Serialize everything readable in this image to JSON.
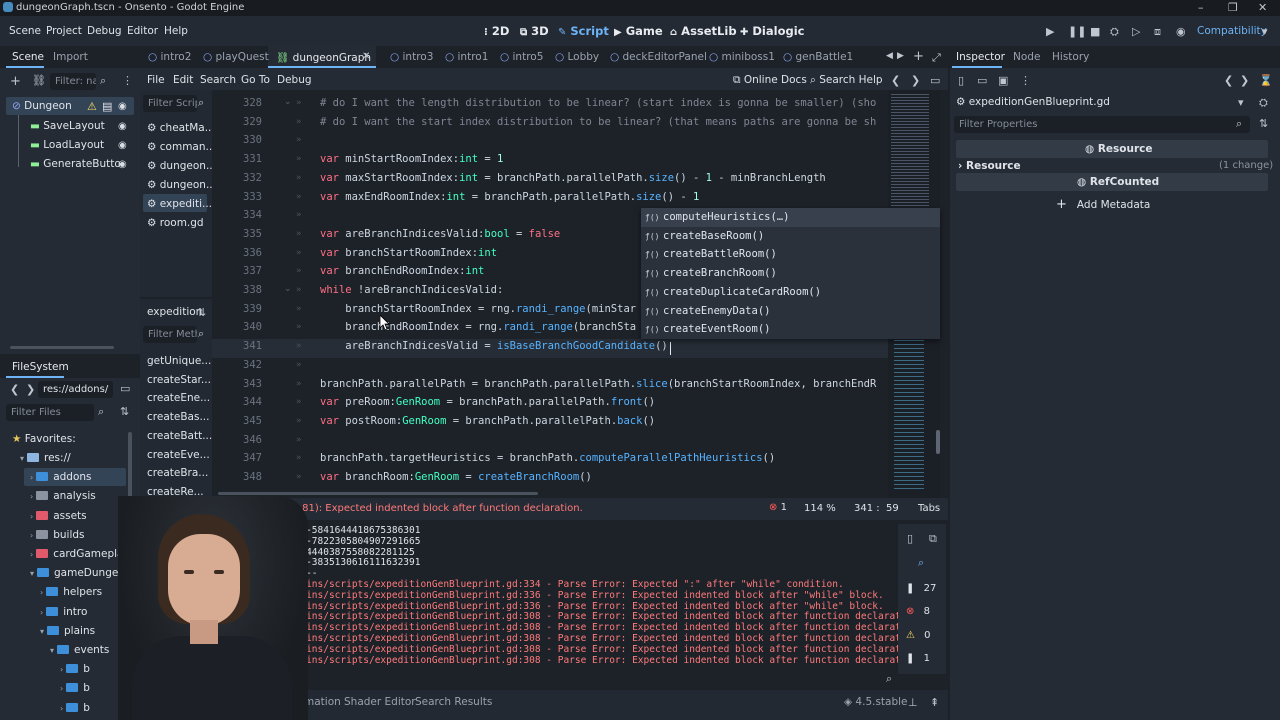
{
  "window": {
    "title": "dungeonGraph.tscn - Onsento - Godot Engine"
  },
  "menu": [
    "Scene",
    "Project",
    "Debug",
    "Editor",
    "Help"
  ],
  "workspaces": [
    {
      "icon": "⁝",
      "label": "2D"
    },
    {
      "icon": "⧉",
      "label": "3D"
    },
    {
      "icon": "✎",
      "label": "Script"
    },
    {
      "icon": "▶",
      "label": "Game"
    },
    {
      "icon": "⌂",
      "label": "AssetLib"
    },
    {
      "icon": "✚",
      "label": "Dialogic"
    }
  ],
  "renderer": "Compatibility",
  "scene_dock": {
    "tabs": [
      "Scene",
      "Import"
    ],
    "filter_placeholder": "Filter: na",
    "root": "Dungeon",
    "children": [
      "SaveLayout",
      "LoadLayout",
      "GenerateButto"
    ]
  },
  "script_list": {
    "filter": "Filter Script",
    "items": [
      "cheatMa...",
      "comman...",
      "dungeon...",
      "dungeon...",
      "expediti...",
      "room.gd"
    ],
    "section": "expedition",
    "method_filter": "Filter Meth",
    "methods": [
      "getUnique...",
      "createStar...",
      "createEne...",
      "createBas...",
      "createBatt...",
      "createEve...",
      "createBra...",
      "createRe..."
    ]
  },
  "filesystem": {
    "title": "FileSystem",
    "path": "res://addons/",
    "filter": "Filter Files",
    "favorites": "Favorites:",
    "items": [
      {
        "name": "res://",
        "color": "#8fb6e0",
        "indent": 0
      },
      {
        "name": "addons",
        "color": "#3d8fd9",
        "indent": 1
      },
      {
        "name": "analysis",
        "color": "#8c93a0",
        "indent": 1
      },
      {
        "name": "assets",
        "color": "#e05a6b",
        "indent": 1
      },
      {
        "name": "builds",
        "color": "#8c93a0",
        "indent": 1
      },
      {
        "name": "cardGameplay",
        "color": "#e05a6b",
        "indent": 1
      },
      {
        "name": "gameDungeon",
        "color": "#3d8fd9",
        "indent": 1
      },
      {
        "name": "helpers",
        "color": "#3d8fd9",
        "indent": 2
      },
      {
        "name": "intro",
        "color": "#3d8fd9",
        "indent": 2
      },
      {
        "name": "plains",
        "color": "#3d8fd9",
        "indent": 2
      },
      {
        "name": "events",
        "color": "#3d8fd9",
        "indent": 3
      },
      {
        "name": "b",
        "color": "#3d8fd9",
        "indent": 4
      },
      {
        "name": "b",
        "color": "#3d8fd9",
        "indent": 4
      },
      {
        "name": "b",
        "color": "#3d8fd9",
        "indent": 4
      }
    ]
  },
  "editor_tabs": [
    "intro2",
    "playQuest",
    "dungeonGraph",
    "intro3",
    "intro1",
    "intro5",
    "Lobby",
    "deckEditorPanel",
    "miniboss1",
    "genBattle1"
  ],
  "script_menu": [
    "File",
    "Edit",
    "Search",
    "Go To",
    "Debug"
  ],
  "script_actions": {
    "online_docs": "Online Docs",
    "search_help": "Search Help"
  },
  "code": [
    {
      "n": "328",
      "html": "<span class='cm'># do I want the length distribution to be linear? (start index is gonna be smaller) (sho</span>"
    },
    {
      "n": "329",
      "html": "<span class='cm'># do I want the start index distribution to be linear? (that means paths are gonna be sh</span>"
    },
    {
      "n": "330",
      "html": ""
    },
    {
      "n": "331",
      "html": "<span class='kw'>var</span> minStartRoomIndex:<span class='ty'>int</span> = <span class='nm'>1</span>"
    },
    {
      "n": "332",
      "html": "<span class='kw'>var</span> maxStartRoomIndex:<span class='ty'>int</span> = branchPath.parallelPath.<span class='fn'>size</span>() - <span class='nm'>1</span> - minBranchLength"
    },
    {
      "n": "333",
      "html": "<span class='kw'>var</span> maxEndRoomIndex:<span class='ty'>int</span> = branchPath.parallelPath.<span class='fn'>size</span>() - <span class='nm'>1</span>"
    },
    {
      "n": "334",
      "html": ""
    },
    {
      "n": "335",
      "html": "<span class='kw'>var</span> areBranchIndicesValid:<span class='ty'>bool</span> = <span class='kw'>false</span>"
    },
    {
      "n": "336",
      "html": "<span class='kw'>var</span> branchStartRoomIndex:<span class='ty'>int</span>"
    },
    {
      "n": "337",
      "html": "<span class='kw'>var</span> branchEndRoomIndex:<span class='ty'>int</span>"
    },
    {
      "n": "338",
      "html": "<span class='kw'>while</span> !areBranchIndicesValid:"
    },
    {
      "n": "339",
      "html": "    branchStartRoomIndex = rng.<span class='fn'>randi_range</span>(minStar"
    },
    {
      "n": "340",
      "html": "    branchEndRoomIndex = rng.<span class='fn'>randi_range</span>(branchSta"
    },
    {
      "n": "341",
      "html": "    areBranchIndicesValid = <span class='fn'>isBaseBranchGoodCandidate</span>()"
    },
    {
      "n": "342",
      "html": ""
    },
    {
      "n": "343",
      "html": "branchPath.parallelPath = branchPath.parallelPath.<span class='fn'>slice</span>(branchStartRoomIndex, branchEndR"
    },
    {
      "n": "344",
      "html": "<span class='kw'>var</span> preRoom:<span class='ty'>GenRoom</span> = branchPath.parallelPath.<span class='fn'>front</span>()"
    },
    {
      "n": "345",
      "html": "<span class='kw'>var</span> postRoom:<span class='ty'>GenRoom</span> = branchPath.parallelPath.<span class='fn'>back</span>()"
    },
    {
      "n": "346",
      "html": ""
    },
    {
      "n": "347",
      "html": "branchPath.targetHeuristics = branchPath.<span class='fn'>computeParallelPathHeuristics</span>()"
    },
    {
      "n": "348",
      "html": "<span class='kw'>var</span> branchRoom:<span class='ty'>GenRoom</span> = <span class='fn'>createBranchRoom</span>()"
    }
  ],
  "autocomplete": [
    "computeHeuristics(…)",
    "createBaseRoom()",
    "createBattleRoom()",
    "createBranchRoom()",
    "createDuplicateCardRoom()",
    "createEnemyData()",
    "createEventRoom()"
  ],
  "status": {
    "error": "Error at (308, 81): Expected indented block after function declaration.",
    "error_count": "1",
    "zoom": "114 %",
    "position": "341 :  59",
    "indent": "Tabs"
  },
  "output_log": [
    {
      "t": "on with seed: -5841644418675386301",
      "c": "norm"
    },
    {
      "t": "on with seed: -7822305804907291665",
      "c": "norm"
    },
    {
      "t": "on with seed: 4440387558082281125",
      "c": "norm"
    },
    {
      "t": "on with seed: -3835130616111632391",
      "c": "norm"
    },
    {
      "t": "cess stopped ---",
      "c": "norm"
    },
    {
      "t": "ameDungeon/plains/scripts/expeditionGenBlueprint.gd:334 - Parse Error: Expected \":\" after \"while\" condition.",
      "c": "err"
    },
    {
      "t": "ameDungeon/plains/scripts/expeditionGenBlueprint.gd:336 - Parse Error: Expected indented block after \"while\" block.",
      "c": "err"
    },
    {
      "t": "ameDungeon/plains/scripts/expeditionGenBlueprint.gd:336 - Parse Error: Expected indented block after \"while\" block.",
      "c": "err"
    },
    {
      "t": "ameDungeon/plains/scripts/expeditionGenBlueprint.gd:308 - Parse Error: Expected indented block after function declaration.",
      "c": "err"
    },
    {
      "t": "ameDungeon/plains/scripts/expeditionGenBlueprint.gd:308 - Parse Error: Expected indented block after function declaration.",
      "c": "err"
    },
    {
      "t": "ameDungeon/plains/scripts/expeditionGenBlueprint.gd:308 - Parse Error: Expected indented block after function declaration.",
      "c": "err"
    },
    {
      "t": "ameDungeon/plains/scripts/expeditionGenBlueprint.gd:308 - Parse Error: Expected indented block after function declaration.",
      "c": "err"
    },
    {
      "t": "ameDungeon/plains/scripts/expeditionGenBlueprint.gd:308 - Parse Error: Expected indented block after function declaration.",
      "c": "err"
    }
  ],
  "log_counts": {
    "messages": "27",
    "errors": "8",
    "warnings": "0",
    "info": "1"
  },
  "bottom_tabs": [
    "mation",
    "Shader Editor",
    "Search Results"
  ],
  "version": "4.5.stable",
  "inspector": {
    "tabs": [
      "Inspector",
      "Node",
      "History"
    ],
    "resource_file": "expeditionGenBlueprint.gd",
    "filter": "Filter Properties",
    "section": "Resource",
    "resource_label": "Resource",
    "change": "(1 change)",
    "refcounted": "RefCounted",
    "add_metadata": "Add Metadata"
  }
}
